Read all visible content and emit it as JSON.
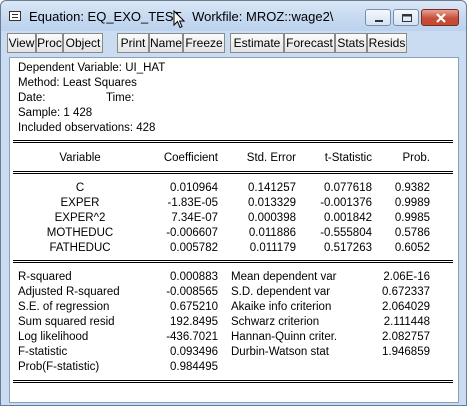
{
  "window": {
    "title": "Equation: EQ_EXO_TEST   Workfile: MROZ::wage2\\"
  },
  "toolbar": {
    "buttons": [
      "View",
      "Proc",
      "Object",
      "Print",
      "Name",
      "Freeze",
      "Estimate",
      "Forecast",
      "Stats",
      "Resids"
    ]
  },
  "header": {
    "dependent": "Dependent Variable: UI_HAT",
    "method": "Method: Least Squares",
    "date": "Date:",
    "time": "Time:",
    "sample": "Sample: 1 428",
    "observations": "Included observations: 428"
  },
  "table": {
    "columns": [
      "Variable",
      "Coefficient",
      "Std. Error",
      "t-Statistic",
      "Prob."
    ],
    "rows": [
      [
        "C",
        "0.010964",
        "0.141257",
        "0.077618",
        "0.9382"
      ],
      [
        "EXPER",
        "-1.83E-05",
        "0.013329",
        "-0.001376",
        "0.9989"
      ],
      [
        "EXPER^2",
        "7.34E-07",
        "0.000398",
        "0.001842",
        "0.9985"
      ],
      [
        "MOTHEDUC",
        "-0.006607",
        "0.011886",
        "-0.555804",
        "0.5786"
      ],
      [
        "FATHEDUC",
        "0.005782",
        "0.011179",
        "0.517263",
        "0.6052"
      ]
    ]
  },
  "stats": {
    "left": [
      [
        "R-squared",
        "0.000883"
      ],
      [
        "Adjusted R-squared",
        "-0.008565"
      ],
      [
        "S.E. of regression",
        "0.675210"
      ],
      [
        "Sum squared resid",
        "192.8495"
      ],
      [
        "Log likelihood",
        "-436.7021"
      ],
      [
        "F-statistic",
        "0.093496"
      ],
      [
        "Prob(F-statistic)",
        "0.984495"
      ]
    ],
    "right": [
      [
        "Mean dependent var",
        "2.06E-16"
      ],
      [
        "S.D. dependent var",
        "0.672337"
      ],
      [
        "Akaike info criterion",
        "2.064029"
      ],
      [
        "Schwarz criterion",
        "2.111448"
      ],
      [
        "Hannan-Quinn criter.",
        "2.082757"
      ],
      [
        "Durbin-Watson stat",
        "1.946859"
      ]
    ]
  }
}
